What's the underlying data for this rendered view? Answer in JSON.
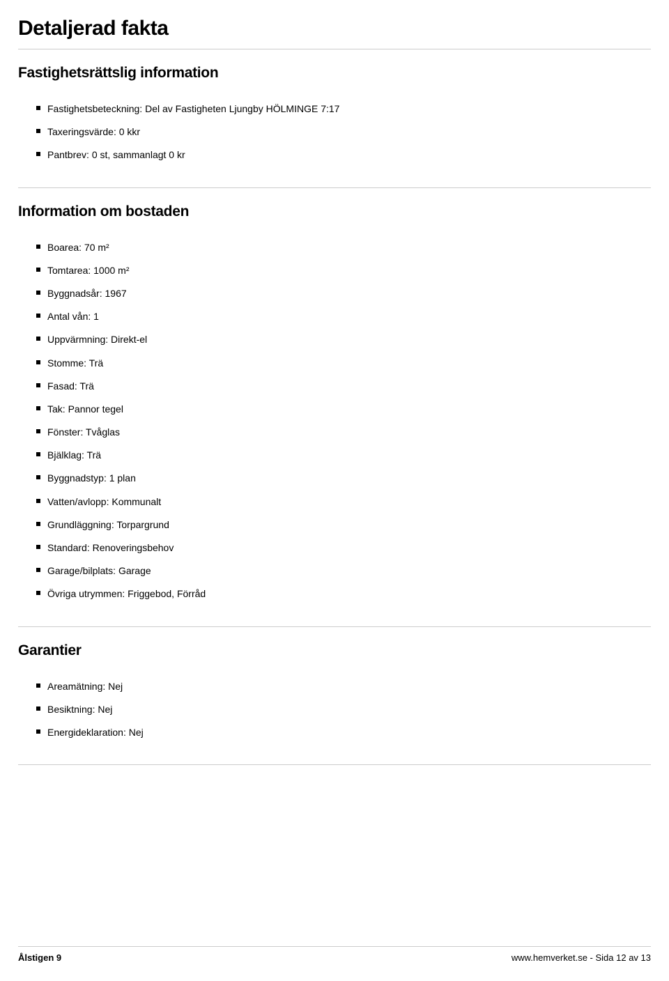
{
  "page_title": "Detaljerad fakta",
  "sections": [
    {
      "title": "Fastighetsrättslig information",
      "items": [
        "Fastighetsbeteckning: Del av Fastigheten Ljungby HÖLMINGE 7:17",
        "Taxeringsvärde: 0 kkr",
        "Pantbrev: 0 st, sammanlagt 0 kr"
      ]
    },
    {
      "title": "Information om bostaden",
      "items": [
        "Boarea: 70 m²",
        "Tomtarea: 1000 m²",
        "Byggnadsår: 1967",
        "Antal vån: 1",
        "Uppvärmning: Direkt-el",
        "Stomme: Trä",
        "Fasad: Trä",
        "Tak: Pannor tegel",
        "Fönster: Tvåglas",
        "Bjälklag: Trä",
        "Byggnadstyp: 1 plan",
        "Vatten/avlopp: Kommunalt",
        "Grundläggning: Torpargrund",
        "Standard: Renoveringsbehov",
        "Garage/bilplats: Garage",
        "Övriga utrymmen: Friggebod, Förråd"
      ]
    },
    {
      "title": "Garantier",
      "items": [
        "Areamätning: Nej",
        "Besiktning: Nej",
        "Energideklaration: Nej"
      ]
    }
  ],
  "footer": {
    "left": "Ålstigen 9",
    "right": "www.hemverket.se - Sida 12 av 13"
  }
}
